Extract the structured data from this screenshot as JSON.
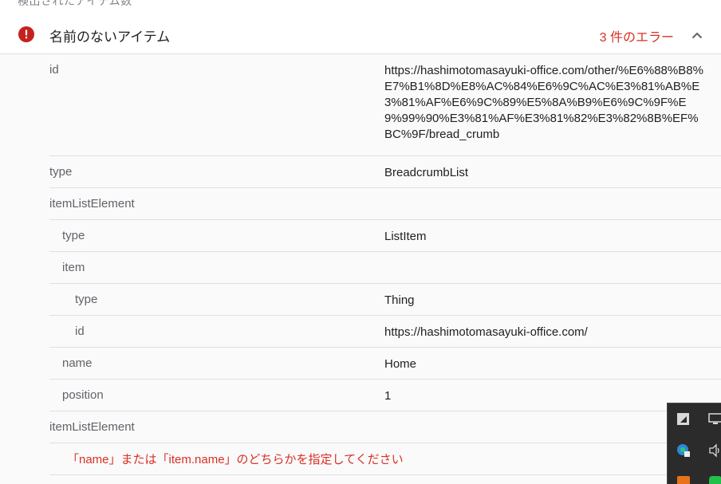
{
  "header": {
    "caption": "検出されたアイテム数",
    "item_title": "名前のないアイテム",
    "error_count": "3 件のエラー",
    "icons": {
      "status": "error-circle-icon",
      "collapse": "chevron-up-icon"
    },
    "colors": {
      "error": "#c5221f",
      "error_text": "#d93025"
    }
  },
  "rows": [
    {
      "key": "id",
      "value": "https://hashimotomasayuki-office.com/other/%E6%88%B8%E7%B1%8D%E8%AC%84%E6%9C%AC%E3%81%AB%E3%81%AF%E6%9C%89%E5%8A%B9%E6%9C%9F%E9%99%90%E3%81%AF%E3%81%82%E3%82%8B%EF%BC%9F/bread_crumb"
    },
    {
      "key": "type",
      "value": "BreadcrumbList"
    },
    {
      "key": "itemListElement",
      "value": ""
    },
    {
      "key": "type",
      "value": "ListItem"
    },
    {
      "key": "item",
      "value": ""
    },
    {
      "key": "type",
      "value": "Thing"
    },
    {
      "key": "id",
      "value": "https://hashimotomasayuki-office.com/"
    },
    {
      "key": "name",
      "value": "Home"
    },
    {
      "key": "position",
      "value": "1"
    },
    {
      "key": "itemListElement",
      "value": ""
    }
  ],
  "error_message": "「name」または「item.name」のどちらかを指定してください",
  "tray": {
    "icons": [
      "snipping-tool-icon",
      "network-icon",
      "edge-update-icon",
      "volume-icon",
      "app-icon",
      "line-icon"
    ]
  }
}
